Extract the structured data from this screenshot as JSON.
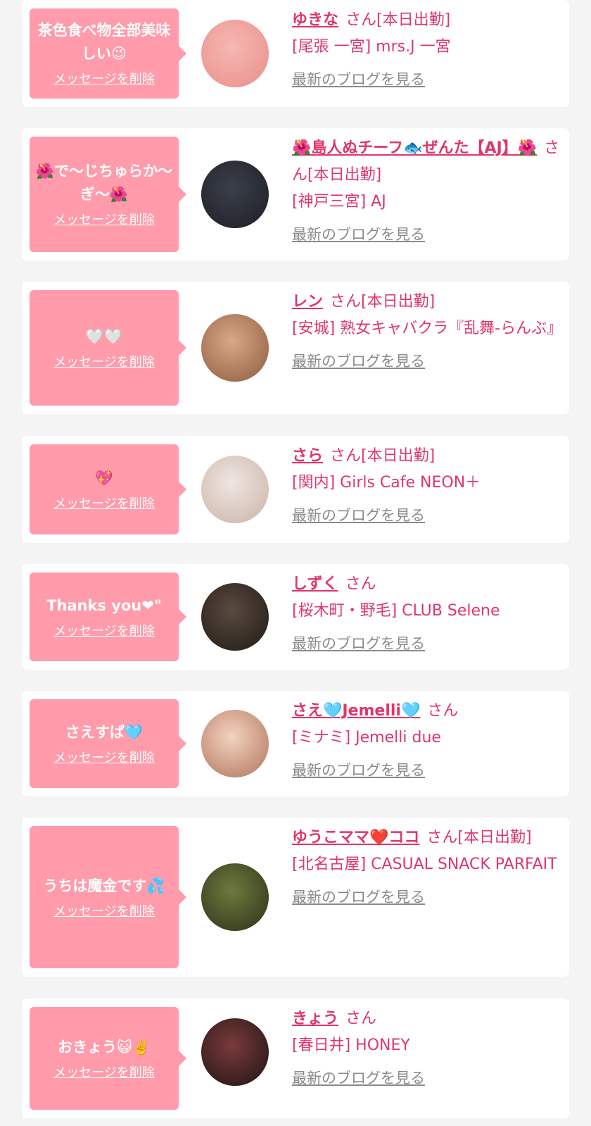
{
  "cards": [
    {
      "message": "茶色食べ物全部美味しい😉",
      "delete_label": "メッセージを削除",
      "name": "ゆきな",
      "suffix": "さん[本日出勤]",
      "shop": "[尾張 一宮] mrs.J 一宮",
      "blog_label": "最新のブログを見る",
      "avatar_colors": [
        "#f7b7b2",
        "#e98f8a"
      ]
    },
    {
      "message": "🌺で〜じちゅらか〜ぎ〜🌺",
      "delete_label": "メッセージを削除",
      "name": "🌺島人ぬチーフ🐟ぜんた【AJ】🌺",
      "suffix": "さん[本日出勤]",
      "shop": "[神戸三宮] AJ",
      "blog_label": "最新のブログを見る",
      "avatar_colors": [
        "#3b3f4a",
        "#1c1e24"
      ]
    },
    {
      "message": "🤍🤍",
      "delete_label": "メッセージを削除",
      "name": "レン",
      "suffix": "さん[本日出勤]",
      "shop": "[安城] 熟女キャバクラ『乱舞-らんぶ』",
      "blog_label": "最新のブログを見る",
      "avatar_colors": [
        "#d9a889",
        "#8c5a3c"
      ]
    },
    {
      "message": "💖",
      "delete_label": "メッセージを削除",
      "name": "さら",
      "suffix": "さん[本日出勤]",
      "shop": "[関内] Girls Cafe NEON＋",
      "blog_label": "最新のブログを見る",
      "avatar_colors": [
        "#efe6e2",
        "#c9b3a6"
      ]
    },
    {
      "message": "Thanks you❤︎\"",
      "delete_label": "メッセージを削除",
      "name": "しずく",
      "suffix": "さん",
      "shop": "[桜木町・野毛] CLUB Selene",
      "blog_label": "最新のブログを見る",
      "avatar_colors": [
        "#5a4a40",
        "#201a16"
      ]
    },
    {
      "message": "さえすぱ🩵",
      "delete_label": "メッセージを削除",
      "name": "さえ🩵Jemelli🩵",
      "suffix": "さん",
      "shop": "[ミナミ] Jemelli due",
      "blog_label": "最新のブログを見る",
      "avatar_colors": [
        "#f3d3c0",
        "#b0735a"
      ]
    },
    {
      "message": "うちは魔金です💦",
      "delete_label": "メッセージを削除",
      "name": "ゆうこママ❤️ココ",
      "suffix": "さん[本日出勤]",
      "shop": "[北名古屋] CASUAL SNACK PARFAIT",
      "blog_label": "最新のブログを見る",
      "avatar_colors": [
        "#6e7a3e",
        "#2c3018"
      ]
    },
    {
      "message": "おきょう😺✌️",
      "delete_label": "メッセージを削除",
      "name": "きょう",
      "suffix": "さん",
      "shop": "[春日井] HONEY",
      "blog_label": "最新のブログを見る",
      "avatar_colors": [
        "#7a3a3a",
        "#1e1414"
      ]
    }
  ]
}
